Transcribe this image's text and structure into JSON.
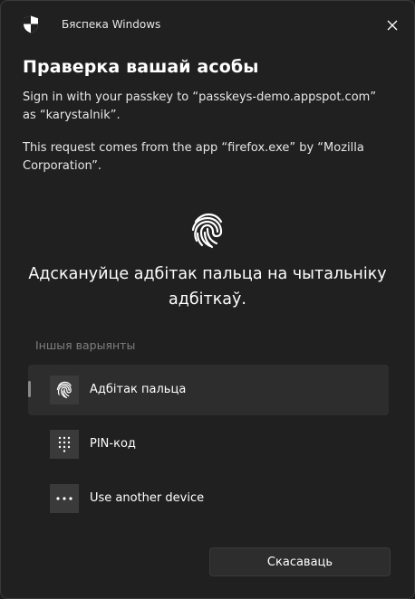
{
  "window": {
    "title": "Бяспека Windows",
    "icon": "shield-icon",
    "close_icon": "close-icon"
  },
  "main": {
    "heading": "Праверка вашай асобы",
    "sign_in_text": "Sign in with your passkey to “passkeys-demo.appspot.com” as “karystalnik”.",
    "request_text": "This request comes from the app “firefox.exe” by “Mozilla Corporation”.",
    "fingerprint_icon": "fingerprint-icon",
    "prompt": "Адскануйце адбітак пальца на чытальніку адбіткаў."
  },
  "options": {
    "label": "Іншыя варыянты",
    "items": [
      {
        "label": "Адбітак пальца",
        "icon": "fingerprint-icon",
        "selected": true
      },
      {
        "label": "PIN-код",
        "icon": "keypad-icon",
        "selected": false
      },
      {
        "label": "Use another device",
        "icon": "more-icon",
        "selected": false
      }
    ]
  },
  "footer": {
    "cancel_label": "Скасаваць"
  },
  "colors": {
    "background": "#202020",
    "selected_option": "#2d2d2d",
    "icon_tile": "#3a3a3a",
    "muted_text": "#7f7f7f"
  }
}
